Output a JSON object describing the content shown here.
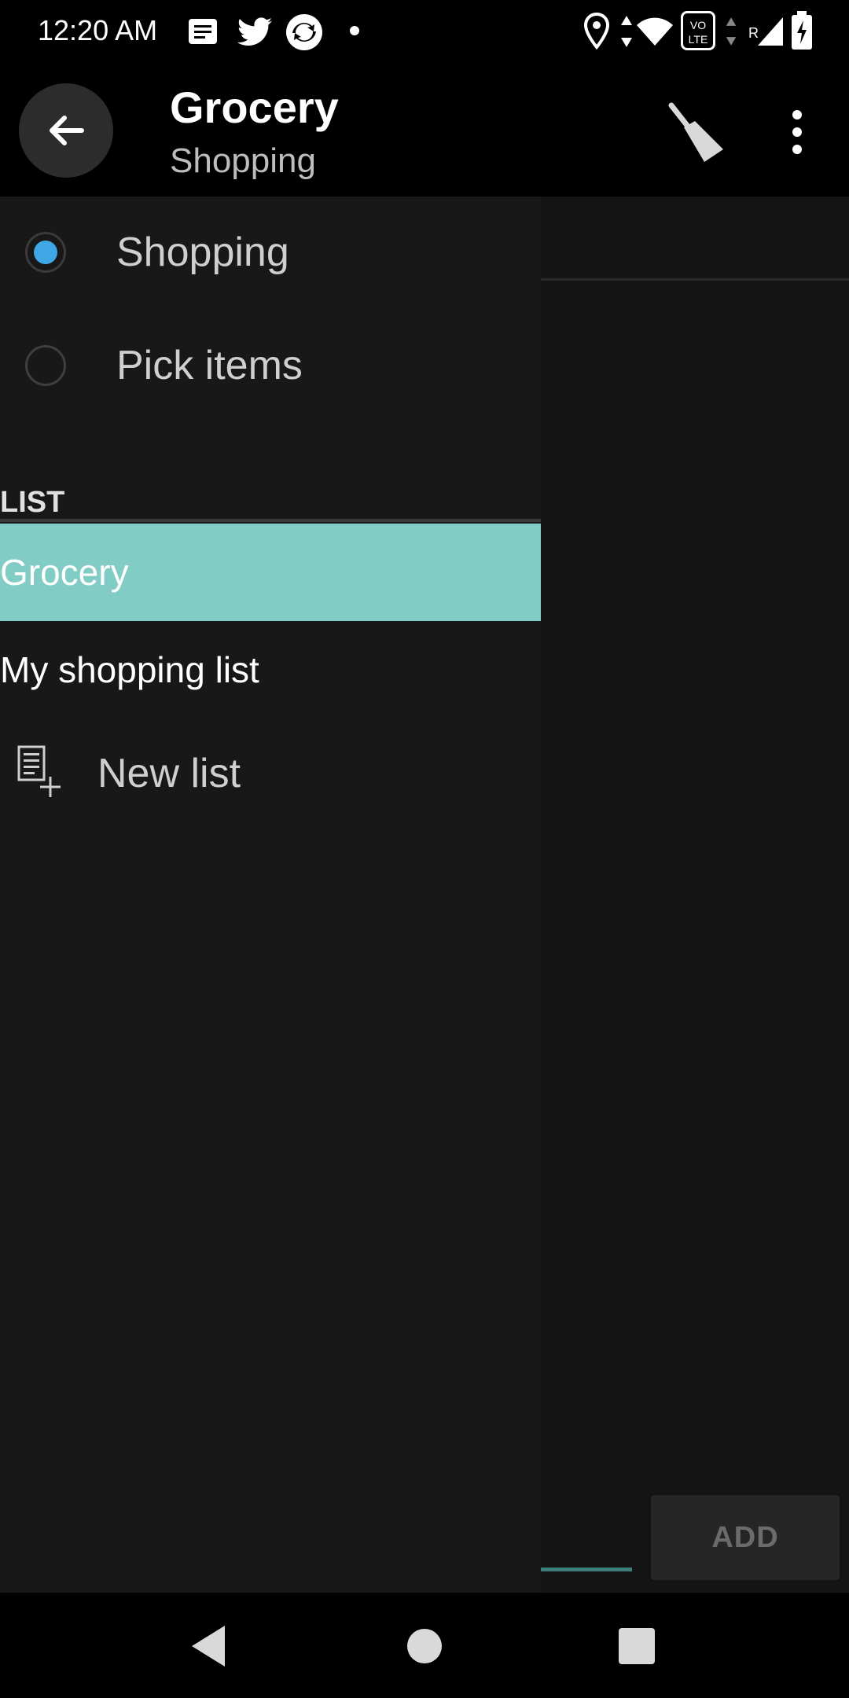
{
  "status_bar": {
    "time": "12:20 AM",
    "left_icons": [
      "message-icon",
      "twitter-icon",
      "sync-app-icon",
      "dot-icon"
    ],
    "right_icons": [
      "location-icon",
      "data-arrows-icon",
      "wifi-icon",
      "volte-icon",
      "data-arrows-icon",
      "signal-roaming-icon",
      "battery-charging-icon"
    ],
    "volte_text": "VO LTE",
    "roaming_text": "R"
  },
  "app_bar": {
    "title": "Grocery",
    "subtitle": "Shopping",
    "back_icon": "arrow-left-icon",
    "clean_icon": "broom-icon",
    "more_icon": "more-vert-icon"
  },
  "drawer": {
    "modes": [
      {
        "label": "Shopping",
        "checked": true
      },
      {
        "label": "Pick items",
        "checked": false
      }
    ],
    "section_title": "LIST",
    "lists": [
      {
        "label": "Grocery",
        "selected": true
      },
      {
        "label": "My shopping list",
        "selected": false
      }
    ],
    "new_list_label": "New list",
    "colors": {
      "selected_bg": "#81ccc5",
      "radio_accent": "#3fa8e4"
    }
  },
  "main": {
    "add_button": "ADD"
  },
  "nav_bar": {
    "back": "nav-back-icon",
    "home": "nav-home-icon",
    "recents": "nav-recents-icon"
  }
}
